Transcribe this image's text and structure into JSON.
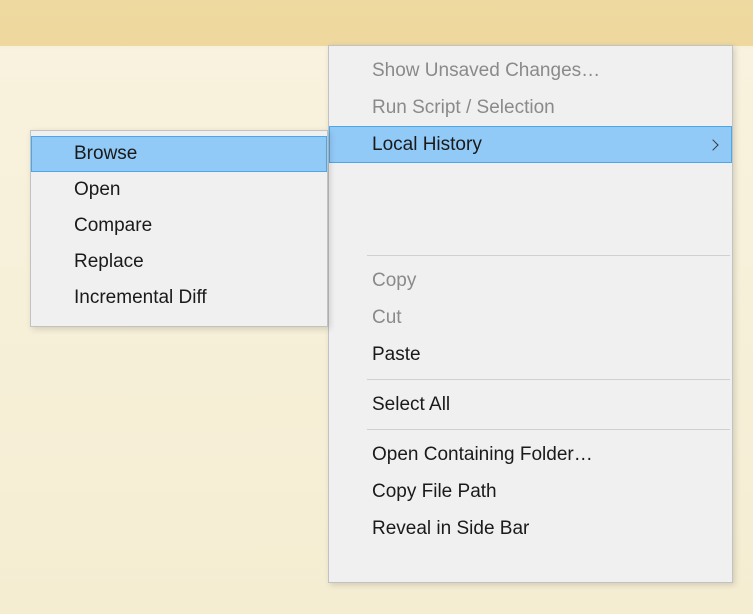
{
  "mainMenu": {
    "group1": {
      "showUnsaved": "Show Unsaved Changes…",
      "runScript": "Run Script / Selection"
    },
    "localHistory": "Local History",
    "editGroup": {
      "copy": "Copy",
      "cut": "Cut",
      "paste": "Paste",
      "selectAll": "Select All"
    },
    "fileGroup": {
      "openFolder": "Open Containing Folder…",
      "copyPath": "Copy File Path",
      "reveal": "Reveal in Side Bar"
    }
  },
  "subMenu": {
    "browse": "Browse",
    "open": "Open",
    "compare": "Compare",
    "replace": "Replace",
    "incrementalDiff": "Incremental Diff"
  }
}
